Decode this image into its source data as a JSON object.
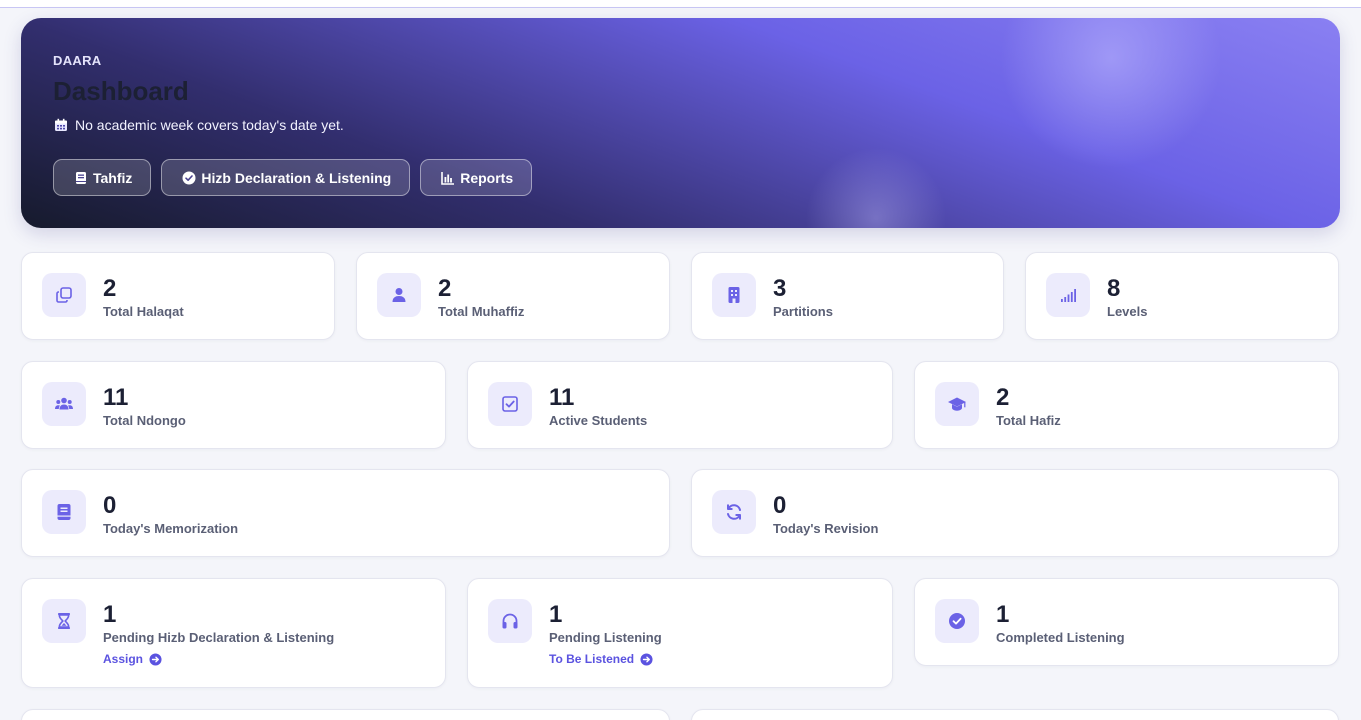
{
  "hero": {
    "kicker": "DAARA",
    "title": "Dashboard",
    "subtitle": "No academic week covers today's date yet.",
    "buttons": [
      {
        "label": "Tahfiz",
        "icon": "book-icon"
      },
      {
        "label": "Hizb Declaration & Listening",
        "icon": "check-circle-icon"
      },
      {
        "label": "Reports",
        "icon": "bar-chart-icon"
      }
    ]
  },
  "stats": [
    {
      "value": "2",
      "label": "Total Halaqat",
      "icon": "clone-icon"
    },
    {
      "value": "2",
      "label": "Total Muhaffiz",
      "icon": "user-icon"
    },
    {
      "value": "3",
      "label": "Partitions",
      "icon": "building-icon"
    },
    {
      "value": "8",
      "label": "Levels",
      "icon": "signal-icon"
    },
    {
      "value": "11",
      "label": "Total Ndongo",
      "icon": "users-icon"
    },
    {
      "value": "11",
      "label": "Active Students",
      "icon": "check-square-icon"
    },
    {
      "value": "2",
      "label": "Total Hafiz",
      "icon": "graduation-cap-icon"
    },
    {
      "value": "0",
      "label": "Today's Memorization",
      "icon": "book-icon"
    },
    {
      "value": "0",
      "label": "Today's Revision",
      "icon": "sync-icon"
    },
    {
      "value": "1",
      "label": "Pending Hizb Declaration & Listening",
      "icon": "hourglass-icon",
      "link": "Assign"
    },
    {
      "value": "1",
      "label": "Pending Listening",
      "icon": "headphones-icon",
      "link": "To Be Listened"
    },
    {
      "value": "1",
      "label": "Completed Listening",
      "icon": "check-circle-icon"
    }
  ],
  "colors": {
    "accent": "#6b62e6",
    "icon_bg": "#ecebfc",
    "page_bg": "#f4f5fa"
  }
}
